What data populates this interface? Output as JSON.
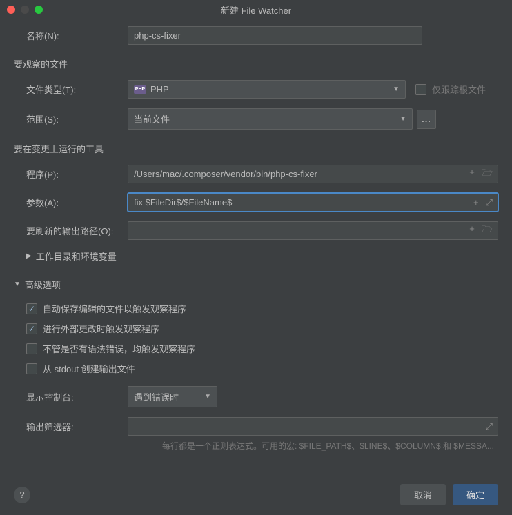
{
  "window": {
    "title": "新建 File Watcher"
  },
  "fields": {
    "name_label": "名称(N):",
    "name_value": "php-cs-fixer",
    "section_watch": "要观察的文件",
    "file_type_label": "文件类型(T):",
    "file_type_value": "PHP",
    "track_root_label": "仅跟踪根文件",
    "scope_label": "范围(S):",
    "scope_value": "当前文件",
    "section_tool": "要在变更上运行的工具",
    "program_label": "程序(P):",
    "program_value": "/Users/mac/.composer/vendor/bin/php-cs-fixer",
    "args_label": "参数(A):",
    "args_value": "fix $FileDir$/$FileName$",
    "output_label": "要刷新的输出路径(O):",
    "output_value": "",
    "working_dir_label": "工作目录和环境变量",
    "section_advanced": "高级选项",
    "chk_auto_save": "自动保存编辑的文件以触发观察程序",
    "chk_external": "进行外部更改时触发观察程序",
    "chk_syntax": "不管是否有语法错误，均触发观察程序",
    "chk_stdout": "从 stdout 创建输出文件",
    "console_label": "显示控制台:",
    "console_value": "遇到错误时",
    "filter_label": "输出筛选器:",
    "filter_value": "",
    "hint": "每行都是一个正则表达式。可用的宏: $FILE_PATH$、$LINE$、$COLUMN$ 和 $MESSA..."
  },
  "buttons": {
    "cancel": "取消",
    "ok": "确定",
    "help": "?"
  }
}
